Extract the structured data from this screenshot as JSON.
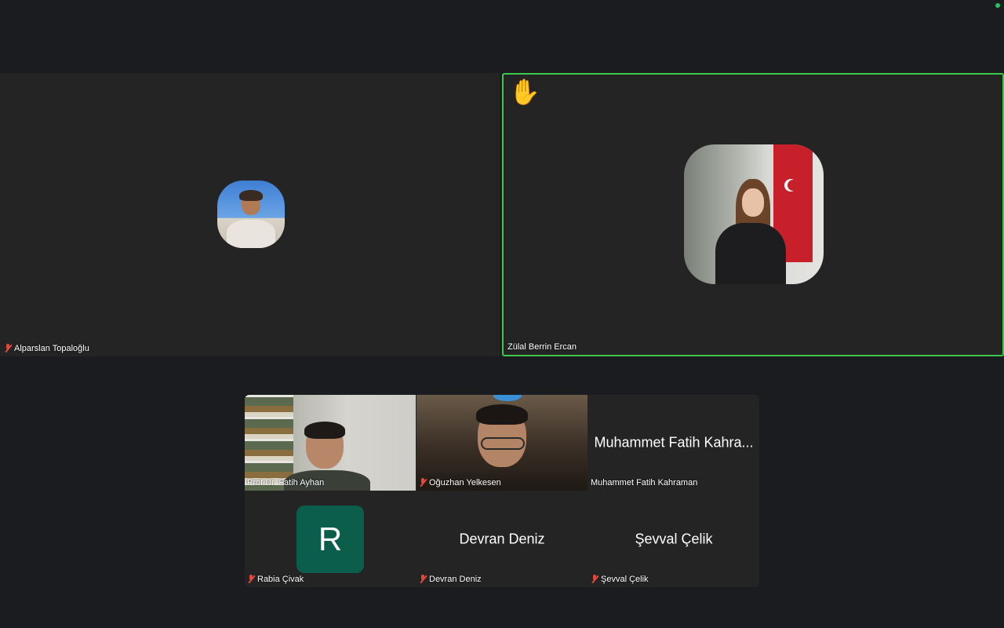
{
  "main_tiles": {
    "left": {
      "name": "Alparslan Topaloğlu",
      "muted": true
    },
    "right": {
      "name": "Zülal Berrin Ercan",
      "muted": false,
      "raised_hand": "✋",
      "active_speaker_color": "#3cc84b"
    }
  },
  "gallery": [
    {
      "name": "Prof.Dr. Fatih Ayhan",
      "muted": false,
      "video": true
    },
    {
      "name": "Oğuzhan Yelkesen",
      "muted": true,
      "video": true
    },
    {
      "name": "Muhammet Fatih Kahraman",
      "display_name": "Muhammet Fatih Kahra...",
      "muted": false,
      "video": false
    },
    {
      "name": "Rabia Çivak",
      "muted": true,
      "video": false,
      "initial": "R",
      "avatar_color": "#0b5e4b"
    },
    {
      "name": "Devran Deniz",
      "display_name": "Devran Deniz",
      "muted": true,
      "video": false
    },
    {
      "name": "Şevval Çelik",
      "display_name": "Şevval Çelik",
      "muted": true,
      "video": false
    }
  ],
  "colors": {
    "background": "#1a1c20",
    "tile": "#242424",
    "muted_icon": "#e5483c",
    "status": "#22c55e"
  }
}
